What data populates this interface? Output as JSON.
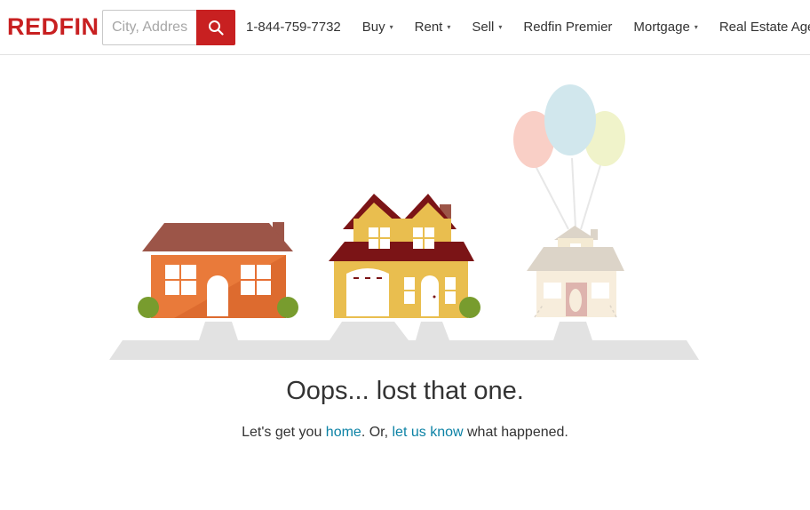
{
  "header": {
    "logo": "REDFIN",
    "search_placeholder": "City, Address, School, Agent, ZIP",
    "phone": "1-844-759-7732",
    "nav": [
      {
        "label": "Buy",
        "caret": "▾"
      },
      {
        "label": "Rent",
        "caret": "▾"
      },
      {
        "label": "Sell",
        "caret": "▾"
      },
      {
        "label": "Redfin Premier",
        "caret": ""
      },
      {
        "label": "Mortgage",
        "caret": "▾"
      },
      {
        "label": "Real Estate Agents",
        "caret": ""
      }
    ]
  },
  "error": {
    "headline": "Oops... lost that one.",
    "line_prefix": "Let's get you ",
    "home_link": "home",
    "line_middle": ". Or, ",
    "contact_link": "let us know",
    "line_suffix": " what happened."
  },
  "colors": {
    "brand_red": "#c82021",
    "link_teal": "#0c82a5",
    "ground": "#e2e2e2"
  },
  "icons": {
    "search": "search-icon"
  }
}
